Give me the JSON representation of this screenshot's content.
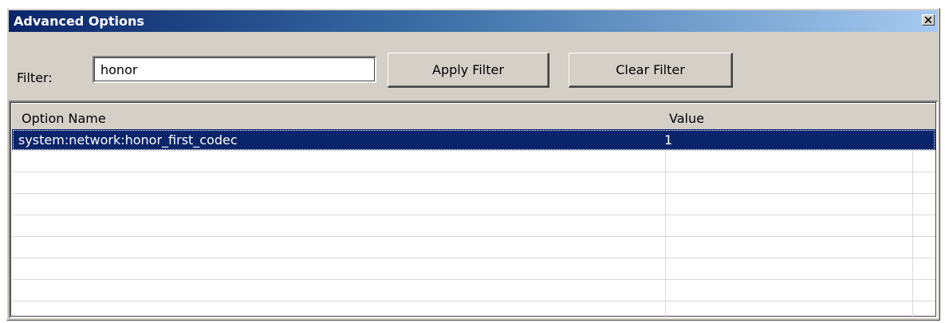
{
  "window": {
    "title": "Advanced Options",
    "close_icon": "close-icon"
  },
  "filter": {
    "label": "Filter:",
    "value": "honor",
    "apply_label": "Apply Filter",
    "clear_label": "Clear Filter"
  },
  "list": {
    "columns": [
      "Option Name",
      "Value"
    ],
    "rows": [
      {
        "name": "system:network:honor_first_codec",
        "value": "1",
        "selected": true
      },
      {
        "name": "",
        "value": ""
      },
      {
        "name": "",
        "value": ""
      },
      {
        "name": "",
        "value": ""
      },
      {
        "name": "",
        "value": ""
      },
      {
        "name": "",
        "value": ""
      },
      {
        "name": "",
        "value": ""
      },
      {
        "name": "",
        "value": ""
      },
      {
        "name": "",
        "value": ""
      }
    ]
  },
  "colors": {
    "selection": "#0a246a",
    "dialog_bg": "#d4d0c8",
    "title_start": "#0a246a",
    "title_end": "#a6caf0"
  }
}
